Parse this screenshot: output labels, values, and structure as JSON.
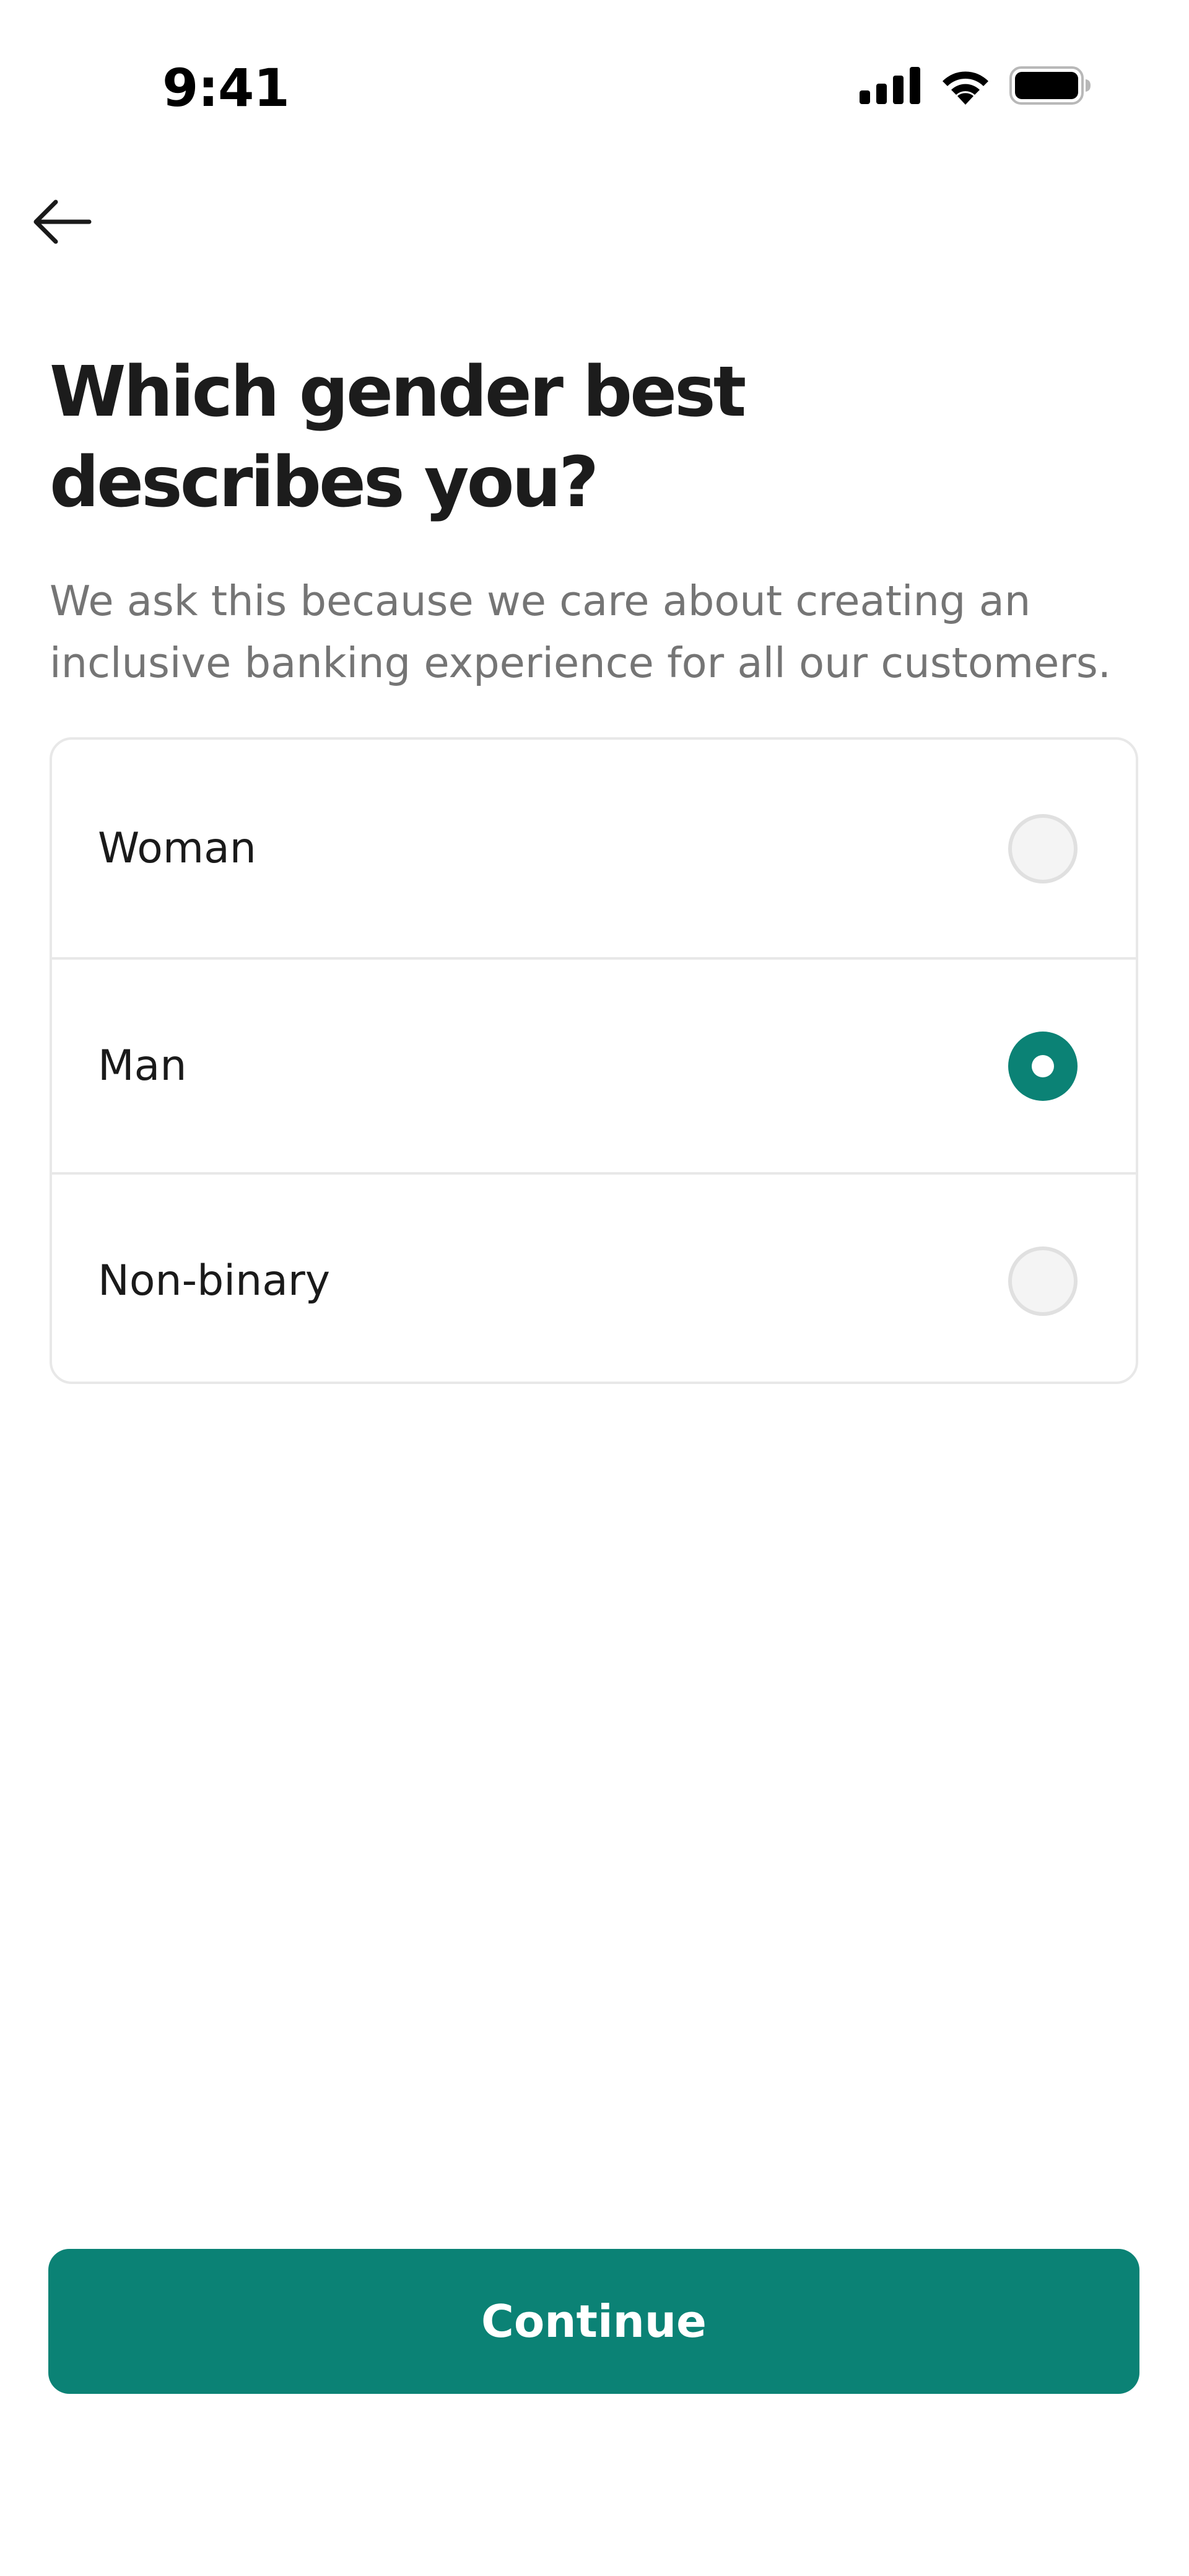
{
  "status_bar": {
    "time": "9:41",
    "icons": [
      "cellular-signal-icon",
      "wifi-icon",
      "battery-icon"
    ]
  },
  "header": {
    "back_icon": "arrow-left-icon"
  },
  "main": {
    "title": "Which gender best describes you?",
    "subtitle": "We ask this because we care about creating an inclusive banking experience for all our customers.",
    "options": [
      {
        "label": "Woman",
        "selected": false
      },
      {
        "label": "Man",
        "selected": true
      },
      {
        "label": "Non-binary",
        "selected": false
      }
    ]
  },
  "footer": {
    "continue_label": "Continue"
  },
  "colors": {
    "accent": "#0b8275",
    "text_primary": "#1c1c1c",
    "text_secondary": "#757575",
    "border": "#e8e8e8"
  }
}
